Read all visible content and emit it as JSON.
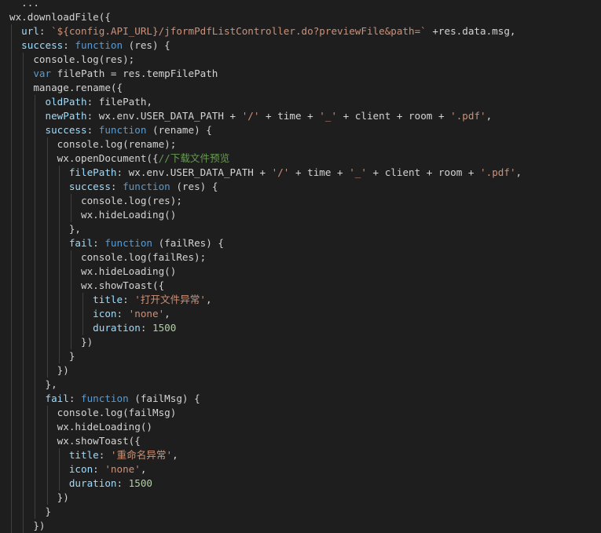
{
  "editor": {
    "theme": {
      "background": "#1e1e1e",
      "text": "#d4d4d4",
      "keyword": "#569cd6",
      "string": "#ce9178",
      "number": "#b5cea8",
      "comment": "#6a9955",
      "property": "#9cdcfe"
    },
    "lines": [
      {
        "indent": 0,
        "tokens": [
          [
            "text",
            "  "
          ],
          [
            "text",
            "..."
          ]
        ]
      },
      {
        "indent": 0,
        "tokens": [
          [
            "text",
            "wx.downloadFile({"
          ]
        ]
      },
      {
        "indent": 1,
        "tokens": [
          [
            "prop",
            "url"
          ],
          [
            "text",
            ": "
          ],
          [
            "tpl",
            "`${config.API_URL}/jformPdfListController.do?previewFile&path=`"
          ],
          [
            "text",
            " +res.data.msg,"
          ]
        ]
      },
      {
        "indent": 1,
        "tokens": [
          [
            "prop",
            "success"
          ],
          [
            "text",
            ": "
          ],
          [
            "keyword",
            "function"
          ],
          [
            "text",
            " (res) {"
          ]
        ]
      },
      {
        "indent": 2,
        "tokens": [
          [
            "text",
            "console.log(res);"
          ]
        ]
      },
      {
        "indent": 2,
        "tokens": [
          [
            "keyword",
            "var"
          ],
          [
            "text",
            " filePath = res.tempFilePath"
          ]
        ]
      },
      {
        "indent": 2,
        "tokens": [
          [
            "text",
            "manage.rename({"
          ]
        ]
      },
      {
        "indent": 3,
        "tokens": [
          [
            "prop",
            "oldPath"
          ],
          [
            "text",
            ": filePath,"
          ]
        ]
      },
      {
        "indent": 3,
        "tokens": [
          [
            "prop",
            "newPath"
          ],
          [
            "text",
            ": wx.env.USER_DATA_PATH + "
          ],
          [
            "string",
            "'/'"
          ],
          [
            "text",
            " + time + "
          ],
          [
            "string",
            "'_'"
          ],
          [
            "text",
            " + client + room + "
          ],
          [
            "string",
            "'.pdf'"
          ],
          [
            "text",
            ","
          ]
        ]
      },
      {
        "indent": 3,
        "tokens": [
          [
            "prop",
            "success"
          ],
          [
            "text",
            ": "
          ],
          [
            "keyword",
            "function"
          ],
          [
            "text",
            " (rename) {"
          ]
        ]
      },
      {
        "indent": 4,
        "tokens": [
          [
            "text",
            "console.log(rename);"
          ]
        ]
      },
      {
        "indent": 4,
        "tokens": [
          [
            "text",
            "wx.openDocument({"
          ],
          [
            "comment",
            "//下载文件预览"
          ]
        ]
      },
      {
        "indent": 5,
        "tokens": [
          [
            "prop",
            "filePath"
          ],
          [
            "text",
            ": wx.env.USER_DATA_PATH + "
          ],
          [
            "string",
            "'/'"
          ],
          [
            "text",
            " + time + "
          ],
          [
            "string",
            "'_'"
          ],
          [
            "text",
            " + client + room + "
          ],
          [
            "string",
            "'.pdf'"
          ],
          [
            "text",
            ","
          ]
        ]
      },
      {
        "indent": 5,
        "tokens": [
          [
            "prop",
            "success"
          ],
          [
            "text",
            ": "
          ],
          [
            "keyword",
            "function"
          ],
          [
            "text",
            " (res) {"
          ]
        ]
      },
      {
        "indent": 6,
        "tokens": [
          [
            "text",
            "console.log(res);"
          ]
        ]
      },
      {
        "indent": 6,
        "tokens": [
          [
            "text",
            "wx.hideLoading()"
          ]
        ]
      },
      {
        "indent": 5,
        "tokens": [
          [
            "text",
            "},"
          ]
        ]
      },
      {
        "indent": 5,
        "tokens": [
          [
            "prop",
            "fail"
          ],
          [
            "text",
            ": "
          ],
          [
            "keyword",
            "function"
          ],
          [
            "text",
            " (failRes) {"
          ]
        ]
      },
      {
        "indent": 6,
        "tokens": [
          [
            "text",
            "console.log(failRes);"
          ]
        ]
      },
      {
        "indent": 6,
        "tokens": [
          [
            "text",
            "wx.hideLoading()"
          ]
        ]
      },
      {
        "indent": 6,
        "tokens": [
          [
            "text",
            "wx.showToast({"
          ]
        ]
      },
      {
        "indent": 7,
        "tokens": [
          [
            "prop",
            "title"
          ],
          [
            "text",
            ": "
          ],
          [
            "string",
            "'打开文件异常'"
          ],
          [
            "text",
            ","
          ]
        ]
      },
      {
        "indent": 7,
        "tokens": [
          [
            "prop",
            "icon"
          ],
          [
            "text",
            ": "
          ],
          [
            "string",
            "'none'"
          ],
          [
            "text",
            ","
          ]
        ]
      },
      {
        "indent": 7,
        "tokens": [
          [
            "prop",
            "duration"
          ],
          [
            "text",
            ": "
          ],
          [
            "number",
            "1500"
          ]
        ]
      },
      {
        "indent": 6,
        "tokens": [
          [
            "text",
            "})"
          ]
        ]
      },
      {
        "indent": 5,
        "tokens": [
          [
            "text",
            "}"
          ]
        ]
      },
      {
        "indent": 4,
        "tokens": [
          [
            "text",
            "})"
          ]
        ]
      },
      {
        "indent": 3,
        "tokens": [
          [
            "text",
            "},"
          ]
        ]
      },
      {
        "indent": 3,
        "tokens": [
          [
            "prop",
            "fail"
          ],
          [
            "text",
            ": "
          ],
          [
            "keyword",
            "function"
          ],
          [
            "text",
            " (failMsg) {"
          ]
        ]
      },
      {
        "indent": 4,
        "tokens": [
          [
            "text",
            "console.log(failMsg)"
          ]
        ]
      },
      {
        "indent": 4,
        "tokens": [
          [
            "text",
            "wx.hideLoading()"
          ]
        ]
      },
      {
        "indent": 4,
        "tokens": [
          [
            "text",
            "wx.showToast({"
          ]
        ]
      },
      {
        "indent": 5,
        "tokens": [
          [
            "prop",
            "title"
          ],
          [
            "text",
            ": "
          ],
          [
            "string",
            "'重命名异常'"
          ],
          [
            "text",
            ","
          ]
        ]
      },
      {
        "indent": 5,
        "tokens": [
          [
            "prop",
            "icon"
          ],
          [
            "text",
            ": "
          ],
          [
            "string",
            "'none'"
          ],
          [
            "text",
            ","
          ]
        ]
      },
      {
        "indent": 5,
        "tokens": [
          [
            "prop",
            "duration"
          ],
          [
            "text",
            ": "
          ],
          [
            "number",
            "1500"
          ]
        ]
      },
      {
        "indent": 4,
        "tokens": [
          [
            "text",
            "})"
          ]
        ]
      },
      {
        "indent": 3,
        "tokens": [
          [
            "text",
            "}"
          ]
        ]
      },
      {
        "indent": 2,
        "tokens": [
          [
            "text",
            "})"
          ]
        ]
      }
    ]
  }
}
